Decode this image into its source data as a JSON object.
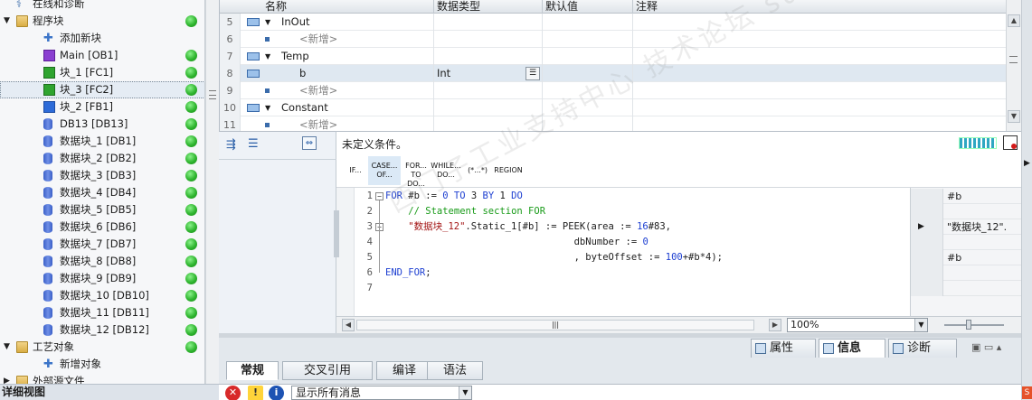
{
  "tree": {
    "items": [
      {
        "label": "在线和诊断",
        "indent": 1,
        "icon": "diagnostic-icon",
        "arrow": "",
        "dot": false
      },
      {
        "label": "程序块",
        "indent": 1,
        "icon": "folder-icon",
        "arrow": "▼",
        "dot": true
      },
      {
        "label": "添加新块",
        "indent": 2,
        "icon": "add-block-icon",
        "arrow": "",
        "dot": false
      },
      {
        "label": "Main [OB1]",
        "indent": 2,
        "icon": "ob-icon",
        "arrow": "",
        "dot": true
      },
      {
        "label": "块_1 [FC1]",
        "indent": 2,
        "icon": "fc-icon",
        "arrow": "",
        "dot": true
      },
      {
        "label": "块_3 [FC2]",
        "indent": 2,
        "icon": "fc-icon",
        "arrow": "",
        "dot": true,
        "selected": true
      },
      {
        "label": "块_2 [FB1]",
        "indent": 2,
        "icon": "fb-icon",
        "arrow": "",
        "dot": true
      },
      {
        "label": "DB13 [DB13]",
        "indent": 2,
        "icon": "db-icon",
        "arrow": "",
        "dot": true
      },
      {
        "label": "数据块_1 [DB1]",
        "indent": 2,
        "icon": "db-icon",
        "arrow": "",
        "dot": true
      },
      {
        "label": "数据块_2 [DB2]",
        "indent": 2,
        "icon": "db-icon",
        "arrow": "",
        "dot": true
      },
      {
        "label": "数据块_3 [DB3]",
        "indent": 2,
        "icon": "db-icon",
        "arrow": "",
        "dot": true
      },
      {
        "label": "数据块_4 [DB4]",
        "indent": 2,
        "icon": "db-icon",
        "arrow": "",
        "dot": true
      },
      {
        "label": "数据块_5 [DB5]",
        "indent": 2,
        "icon": "db-icon",
        "arrow": "",
        "dot": true
      },
      {
        "label": "数据块_6 [DB6]",
        "indent": 2,
        "icon": "db-icon",
        "arrow": "",
        "dot": true
      },
      {
        "label": "数据块_7 [DB7]",
        "indent": 2,
        "icon": "db-icon",
        "arrow": "",
        "dot": true
      },
      {
        "label": "数据块_8 [DB8]",
        "indent": 2,
        "icon": "db-icon",
        "arrow": "",
        "dot": true
      },
      {
        "label": "数据块_9 [DB9]",
        "indent": 2,
        "icon": "db-icon",
        "arrow": "",
        "dot": true
      },
      {
        "label": "数据块_10 [DB10]",
        "indent": 2,
        "icon": "db-icon",
        "arrow": "",
        "dot": true
      },
      {
        "label": "数据块_11 [DB11]",
        "indent": 2,
        "icon": "db-icon",
        "arrow": "",
        "dot": true
      },
      {
        "label": "数据块_12 [DB12]",
        "indent": 2,
        "icon": "db-icon",
        "arrow": "",
        "dot": true
      },
      {
        "label": "工艺对象",
        "indent": 1,
        "icon": "folder-icon",
        "arrow": "▼",
        "dot": true
      },
      {
        "label": "新增对象",
        "indent": 2,
        "icon": "add-block-icon",
        "arrow": "",
        "dot": false
      },
      {
        "label": "外部源文件",
        "indent": 1,
        "icon": "folder-icon",
        "arrow": "▶",
        "dot": false
      }
    ]
  },
  "details": {
    "title": "详细视图"
  },
  "interface": {
    "columns": [
      "名称",
      "数据类型",
      "默认值",
      "注释"
    ],
    "rows": [
      {
        "num": "5",
        "kind": "section",
        "name": "InOut",
        "type": ""
      },
      {
        "num": "6",
        "kind": "new",
        "name": "<新增>",
        "type": ""
      },
      {
        "num": "7",
        "kind": "section",
        "name": "Temp",
        "type": ""
      },
      {
        "num": "8",
        "kind": "var",
        "name": "b",
        "type": "Int",
        "selected": true
      },
      {
        "num": "9",
        "kind": "new",
        "name": "<新增>",
        "type": ""
      },
      {
        "num": "10",
        "kind": "section",
        "name": "Constant",
        "type": ""
      },
      {
        "num": "11",
        "kind": "new",
        "name": "<新增>",
        "type": ""
      }
    ]
  },
  "editor": {
    "condition_label": "未定义条件。",
    "templates": [
      {
        "line1": "IF...",
        "line2": ""
      },
      {
        "line1": "CASE...",
        "line2": "OF..."
      },
      {
        "line1": "FOR...",
        "line2": "TO DO..."
      },
      {
        "line1": "WHILE...",
        "line2": "DO..."
      },
      {
        "line1": "(*...*)",
        "line2": ""
      },
      {
        "line1": "REGION",
        "line2": ""
      }
    ],
    "code_lines": [
      {
        "num": "1",
        "fold": "−",
        "text": "FOR #b := 0 TO 3 BY 1 DO"
      },
      {
        "num": "2",
        "fold": "",
        "text": "    // Statement section FOR"
      },
      {
        "num": "3",
        "fold": "−",
        "text": "    \"数据块_12\".Static_1[#b] := PEEK(area := 16#83,"
      },
      {
        "num": "4",
        "fold": "",
        "text": "                                 dbNumber := 0"
      },
      {
        "num": "5",
        "fold": "",
        "text": "                                 , byteOffset := 100+#b*4);"
      },
      {
        "num": "6",
        "fold": "",
        "text": "END_FOR;"
      },
      {
        "num": "7",
        "fold": "",
        "text": ""
      }
    ],
    "watch": [
      {
        "text": "#b",
        "marker": ""
      },
      {
        "text": "",
        "marker": ""
      },
      {
        "text": "\"数据块_12\".",
        "marker": "▶"
      },
      {
        "text": "",
        "marker": ""
      },
      {
        "text": "#b",
        "marker": ""
      },
      {
        "text": "",
        "marker": ""
      },
      {
        "text": "",
        "marker": ""
      }
    ],
    "zoom": "100%",
    "hscroll_grip": "|||"
  },
  "inspector": {
    "top_tabs": [
      {
        "label": "属性",
        "icon": "properties-icon"
      },
      {
        "label": "信息",
        "icon": "info-icon",
        "active": true
      },
      {
        "label": "诊断",
        "icon": "diagnostics-icon"
      }
    ],
    "sub_tabs": [
      {
        "label": "常规",
        "active": true
      },
      {
        "label": "交叉引用"
      },
      {
        "label": "编译"
      },
      {
        "label": "语法"
      }
    ],
    "message_filter": "显示所有消息"
  },
  "watermark": "西门子工业支持中心 技术论坛 support.industry.siemens.com/cs",
  "colors": {
    "status_ok": "#2fb52f",
    "keyword": "#1d3fd1",
    "comment": "#199b19",
    "string": "#a31515",
    "selection": "#dfe8f1"
  }
}
